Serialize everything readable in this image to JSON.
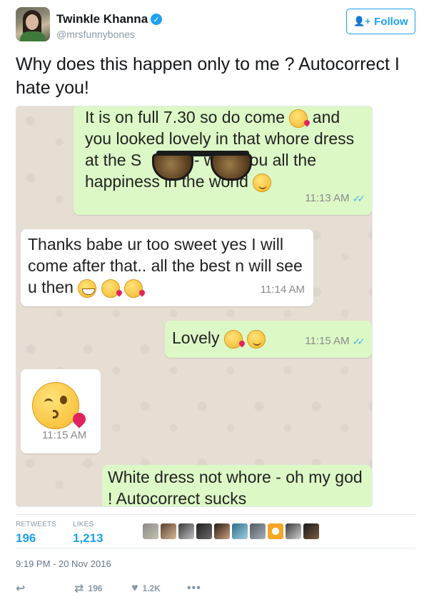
{
  "author": {
    "name": "Twinkle Khanna",
    "handle": "@mrsfunnybones",
    "verified_icon": "verified-badge-icon"
  },
  "follow_button": {
    "label": "Follow",
    "icon": "add-user-icon"
  },
  "tweet": {
    "text": "Why does this happen only to me ? Autocorrect I hate you!"
  },
  "screenshot": {
    "messages": [
      {
        "direction": "out",
        "text_before_emoji": "It is on full 7.30 so do come ",
        "text_after_emoji": " and you looked lovely in that whore dress at the S     ep's- wish you all the happiness in the world ",
        "time": "11:13 AM"
      },
      {
        "direction": "in",
        "text": "Thanks babe ur too sweet yes I will come after that.. all the best n will see u then ",
        "time": "11:14 AM"
      },
      {
        "direction": "out",
        "text": "Lovely ",
        "time": "11:15 AM"
      },
      {
        "direction": "in",
        "text": "",
        "time": "11:15 AM"
      },
      {
        "direction": "out",
        "text": "White dress not whore - oh my god ! Autocorrect sucks"
      }
    ]
  },
  "stats": {
    "retweets_label": "RETWEETS",
    "retweets_value": "196",
    "likes_label": "LIKES",
    "likes_value": "1,213"
  },
  "timestamp": "9:19 PM - 20 Nov 2016",
  "actions": {
    "retweet_count": "196",
    "like_count": "1.2K"
  },
  "colors": {
    "accent": "#1da1f2",
    "outgoing_bubble": "#dcf8c6",
    "chat_background": "#e6ddd3"
  }
}
